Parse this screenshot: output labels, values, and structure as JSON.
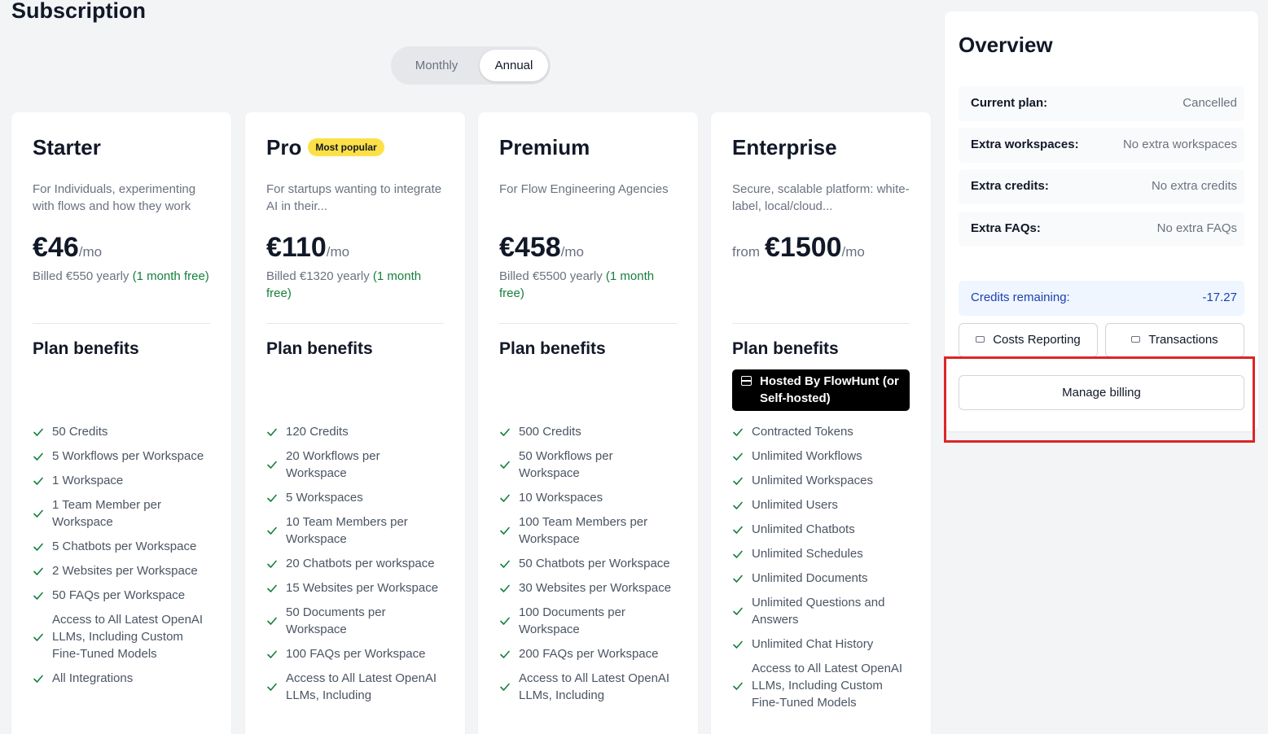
{
  "page": {
    "title": "Subscription"
  },
  "billing_toggle": {
    "monthly_label": "Monthly",
    "annual_label": "Annual",
    "selected": "Annual"
  },
  "plans": [
    {
      "name": "Starter",
      "badge": "",
      "description": "For Individuals, experimenting with flows and how they work",
      "price_prefix": "",
      "price": "€46",
      "per": "/mo",
      "billed": "Billed €550 yearly ",
      "billed_free": "(1 month free)",
      "benefits_title": "Plan benefits",
      "hosted": "",
      "features": [
        "50 Credits",
        "5 Workflows per Workspace",
        "1 Workspace",
        "1 Team Member per Workspace",
        "5 Chatbots per Workspace",
        "2 Websites per Workspace",
        "50 FAQs per Workspace",
        "Access to All Latest OpenAI LLMs, Including Custom Fine-Tuned Models",
        "All Integrations"
      ]
    },
    {
      "name": "Pro",
      "badge": "Most popular",
      "description": "For startups wanting to integrate AI in their...",
      "price_prefix": "",
      "price": "€110",
      "per": "/mo",
      "billed": "Billed €1320 yearly ",
      "billed_free": "(1 month free)",
      "benefits_title": "Plan benefits",
      "hosted": "",
      "features": [
        "120 Credits",
        "20 Workflows per Workspace",
        "5 Workspaces",
        "10 Team Members per Workspace",
        "20 Chatbots per workspace",
        "15 Websites per Workspace",
        "50 Documents per Workspace",
        "100 FAQs per Workspace",
        "Access to All Latest OpenAI LLMs, Including"
      ]
    },
    {
      "name": "Premium",
      "badge": "",
      "description": "For Flow Engineering Agencies",
      "price_prefix": "",
      "price": "€458",
      "per": "/mo",
      "billed": "Billed €5500 yearly ",
      "billed_free": "(1 month free)",
      "benefits_title": "Plan benefits",
      "hosted": "",
      "features": [
        "500 Credits",
        "50 Workflows per Workspace",
        "10 Workspaces",
        "100 Team Members per Workspace",
        "50 Chatbots per Workspace",
        "30 Websites per Workspace",
        "100 Documents per Workspace",
        "200 FAQs per Workspace",
        "Access to All Latest OpenAI LLMs, Including"
      ]
    },
    {
      "name": "Enterprise",
      "badge": "",
      "description": "Secure, scalable platform: white-label, local/cloud...",
      "price_prefix": "from",
      "price": "€1500",
      "per": "/mo",
      "billed": "",
      "billed_free": "",
      "benefits_title": "Plan benefits",
      "hosted": "Hosted By FlowHunt (or Self-hosted)",
      "features": [
        "Contracted Tokens",
        "Unlimited Workflows",
        "Unlimited Workspaces",
        "Unlimited Users",
        "Unlimited Chatbots",
        "Unlimited Schedules",
        "Unlimited Documents",
        "Unlimited Questions and Answers",
        "Unlimited Chat History",
        "Access to All Latest OpenAI LLMs, Including Custom Fine-Tuned Models"
      ]
    }
  ],
  "overview": {
    "title": "Overview",
    "rows": [
      {
        "label": "Current plan:",
        "value": "Cancelled"
      },
      {
        "label": "Extra workspaces:",
        "value": "No extra workspaces"
      },
      {
        "label": "Extra credits:",
        "value": "No extra credits"
      },
      {
        "label": "Extra FAQs:",
        "value": "No extra FAQs"
      }
    ],
    "credits": {
      "label": "Credits remaining:",
      "value": "-17.27"
    },
    "costs_reporting_label": "Costs Reporting",
    "transactions_label": "Transactions",
    "manage_billing_label": "Manage billing"
  },
  "colors": {
    "accent_green": "#15803d",
    "badge_yellow": "#fde047",
    "highlight_red": "#dc2626",
    "credits_blue": "#1e40af"
  }
}
